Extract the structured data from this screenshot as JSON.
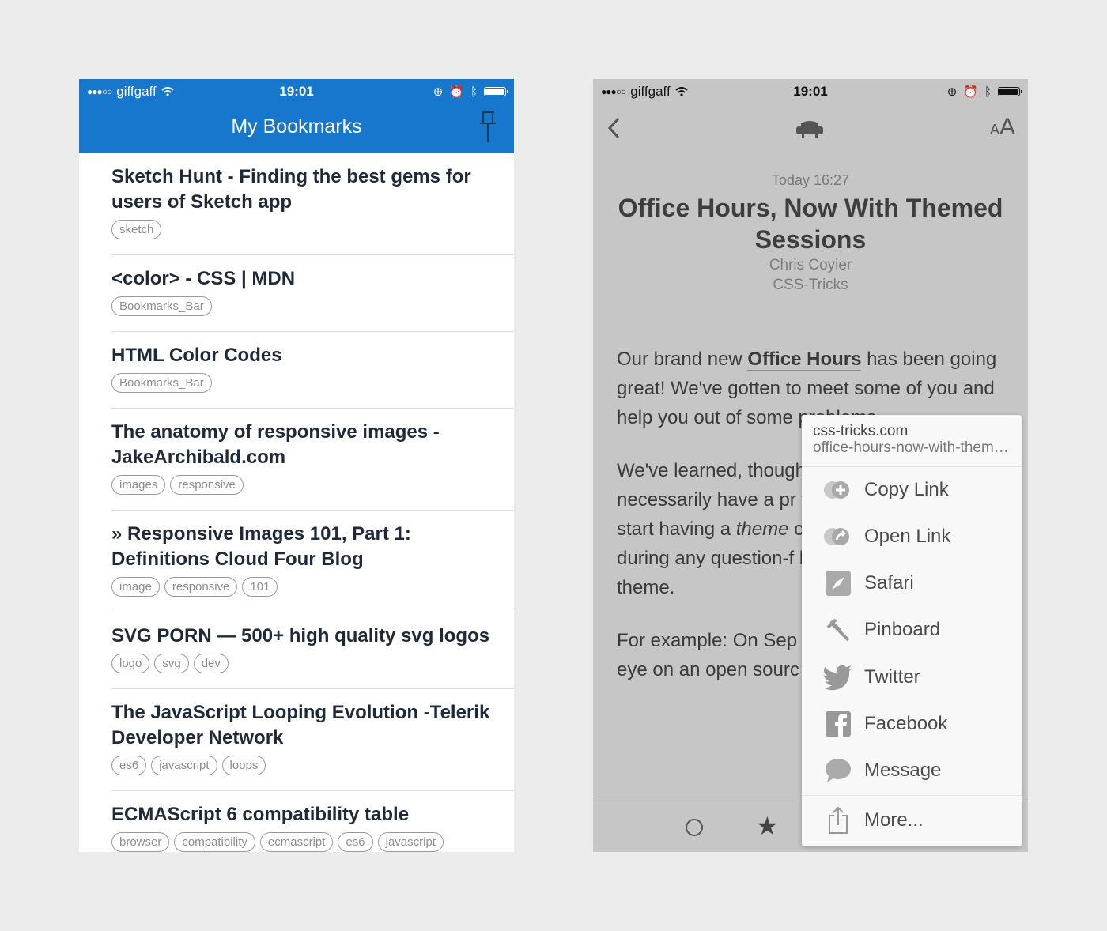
{
  "status_bar": {
    "signal": "●●●○○",
    "carrier": "giffgaff",
    "time": "19:01"
  },
  "bookmarks": {
    "title": "My Bookmarks",
    "items": [
      {
        "title": "Sketch Hunt - Finding the best gems for users of Sketch app",
        "tags": [
          "sketch"
        ]
      },
      {
        "title": "<color> - CSS | MDN",
        "tags": [
          "Bookmarks_Bar"
        ]
      },
      {
        "title": "HTML Color Codes",
        "tags": [
          "Bookmarks_Bar"
        ]
      },
      {
        "title": "The anatomy of responsive images - JakeArchibald.com",
        "tags": [
          "images",
          "responsive"
        ]
      },
      {
        "title": "» Responsive Images 101, Part 1: Definitions Cloud Four Blog",
        "tags": [
          "image",
          "responsive",
          "101"
        ]
      },
      {
        "title": "SVG PORN — 500+ high quality svg logos",
        "tags": [
          "logo",
          "svg",
          "dev"
        ]
      },
      {
        "title": "The JavaScript Looping Evolution -Telerik Developer Network",
        "tags": [
          "es6",
          "javascript",
          "loops"
        ]
      },
      {
        "title": "ECMAScript 6 compatibility table",
        "tags": [
          "browser",
          "compatibility",
          "ecmascript",
          "es6",
          "javascript"
        ]
      }
    ]
  },
  "reader": {
    "text_size_small": "A",
    "text_size_large": "A",
    "date": "Today 16:27",
    "title": "Office Hours, Now With Themed Sessions",
    "author": "Chris Coyier",
    "source": "CSS-Tricks",
    "p1_pre": "Our brand new ",
    "p1_link": "Office Hours",
    "p1_post": " has been going great! We've gotten to meet some of you and help you out of some problems.",
    "p2_pre": "We've learned, though, just like to listen, talk necessarily have a pr with right this second start having a ",
    "p2_em": "theme",
    "p2_post": " can still ask any ques during any question-f leader will show off a that theme.",
    "p3": "For example: On Sep session will be aroun eye on an open sourc could fork and and s"
  },
  "share_menu": {
    "domain": "css-tricks.com",
    "url": "office-hours-now-with-themed-sessions",
    "actions": [
      {
        "label": "Copy Link",
        "icon": "copy-link-icon"
      },
      {
        "label": "Open Link",
        "icon": "open-link-icon"
      },
      {
        "label": "Safari",
        "icon": "safari-icon"
      },
      {
        "label": "Pinboard",
        "icon": "pinboard-icon"
      },
      {
        "label": "Twitter",
        "icon": "twitter-icon"
      },
      {
        "label": "Facebook",
        "icon": "facebook-icon"
      },
      {
        "label": "Message",
        "icon": "message-icon"
      },
      {
        "label": "More...",
        "icon": "share-icon"
      }
    ]
  },
  "colors": {
    "nav_blue": "#1677cc",
    "tag_border": "#9a9a9a",
    "reader_bg": "#c6c6c6"
  }
}
